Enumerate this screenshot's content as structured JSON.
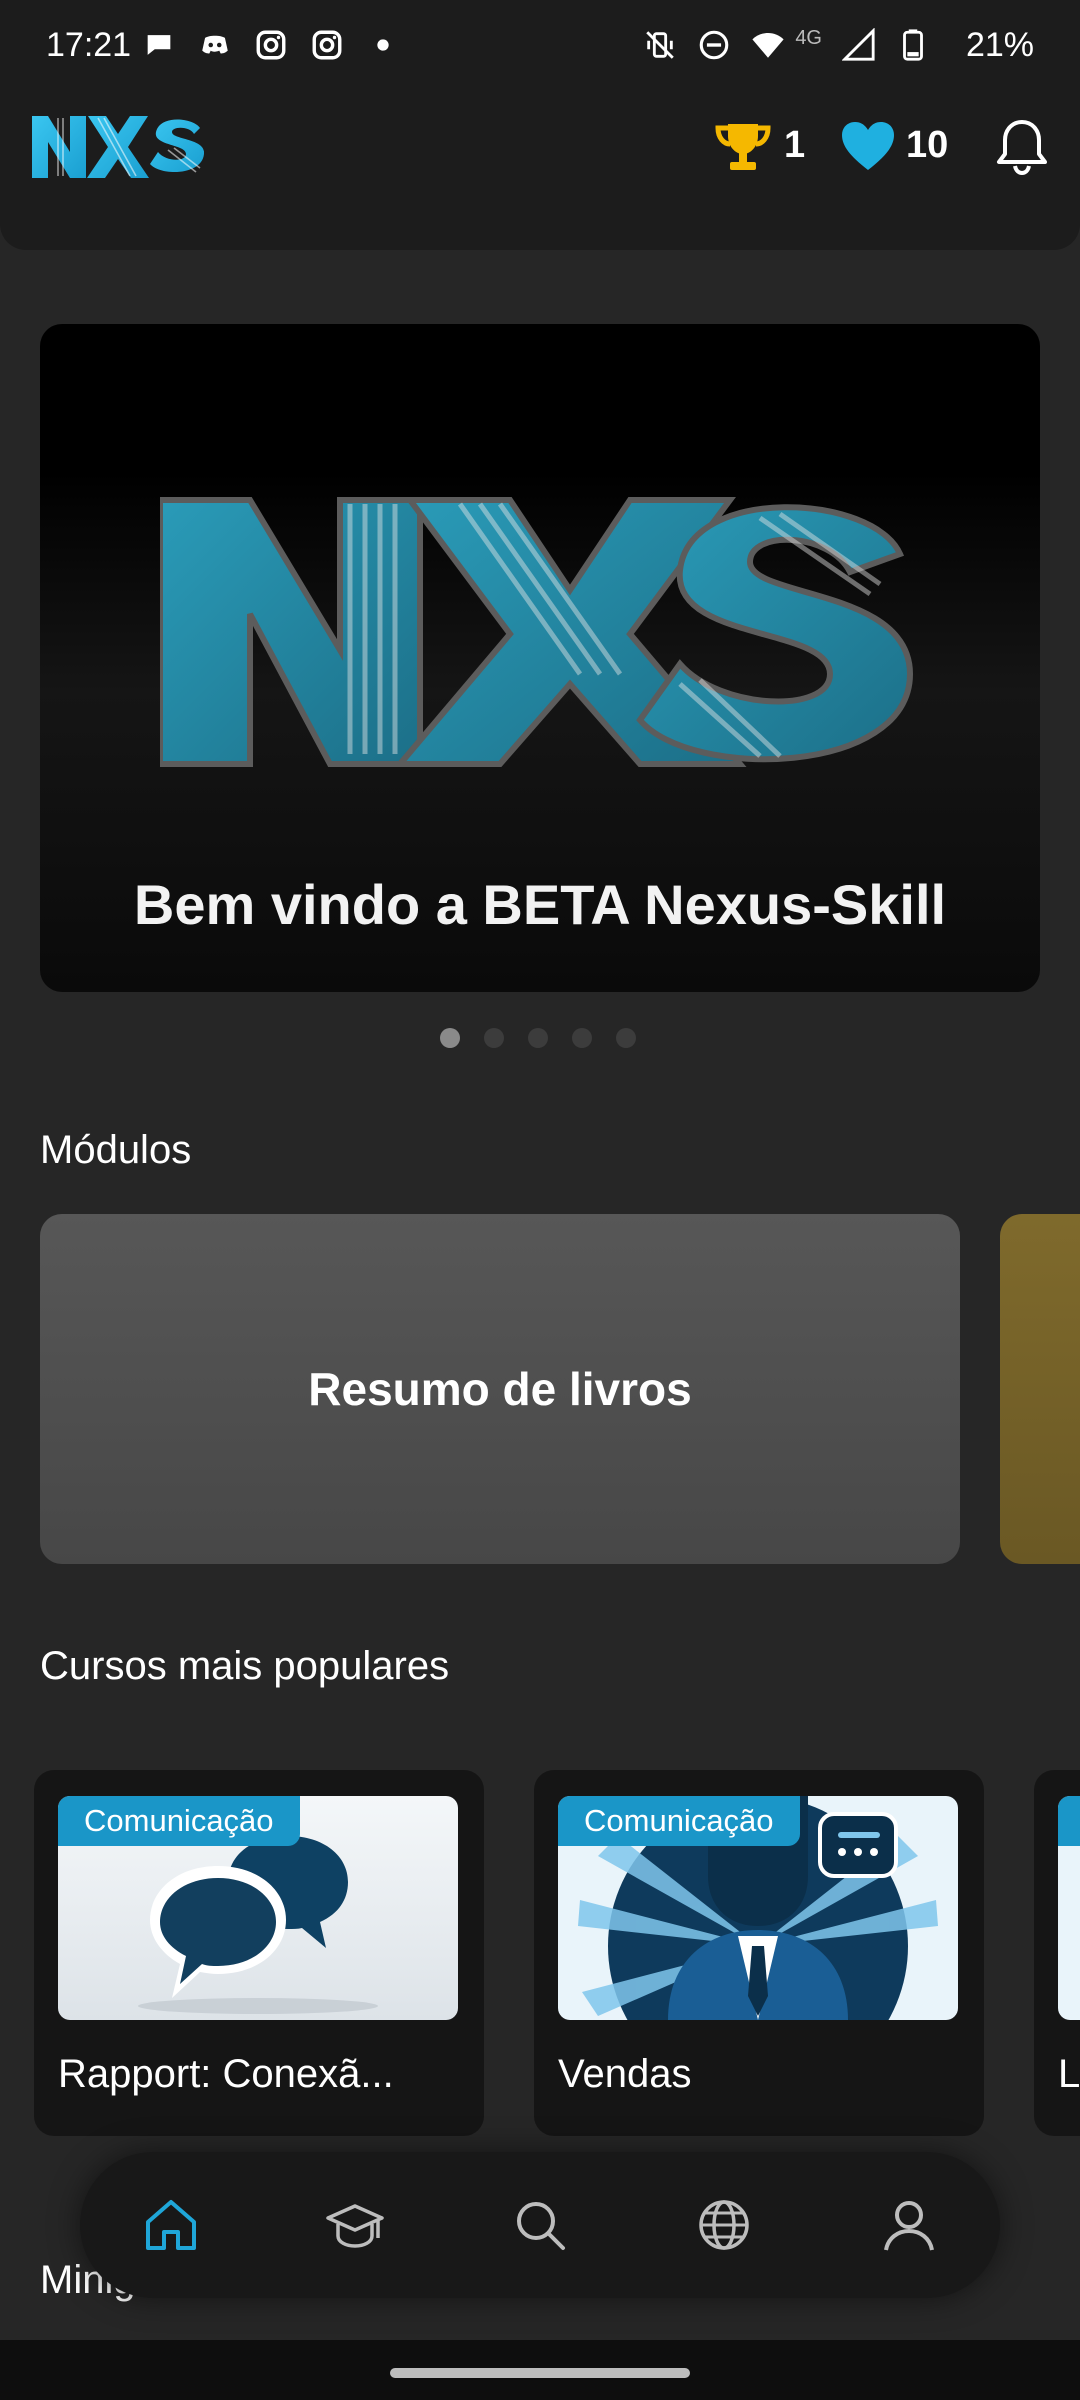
{
  "status_bar": {
    "time": "17:21",
    "battery": "21%",
    "network": "4G",
    "notification_icons": [
      "chat-icon",
      "discord-icon",
      "instagram-icon",
      "instagram-icon",
      "dot-icon"
    ],
    "system_icons": [
      "mute-vibrate-icon",
      "do-not-disturb-icon",
      "wifi-icon",
      "signal-icon",
      "battery-icon"
    ]
  },
  "header": {
    "logo_text": "NXS",
    "trophy_count": "1",
    "heart_count": "10",
    "accent_color": "#1fa6d8",
    "trophy_color": "#f5b800"
  },
  "banner": {
    "logo_text": "NXS",
    "caption": "Bem vindo a BETA Nexus-Skill",
    "slide_count": 5,
    "active_slide": 1
  },
  "modules": {
    "title": "Módulos",
    "items": [
      {
        "label": "Resumo de livros"
      }
    ]
  },
  "popular_courses": {
    "title": "Cursos mais populares",
    "items": [
      {
        "tag": "Comunicação",
        "title": "Rapport: Conexã..."
      },
      {
        "tag": "Comunicação",
        "title": "Vendas"
      },
      {
        "title": "Li"
      }
    ]
  },
  "next_section_partial": "Minig",
  "bottom_nav": {
    "items": [
      "home-icon",
      "courses-icon",
      "search-icon",
      "globe-icon",
      "profile-icon"
    ],
    "active": "home-icon"
  }
}
